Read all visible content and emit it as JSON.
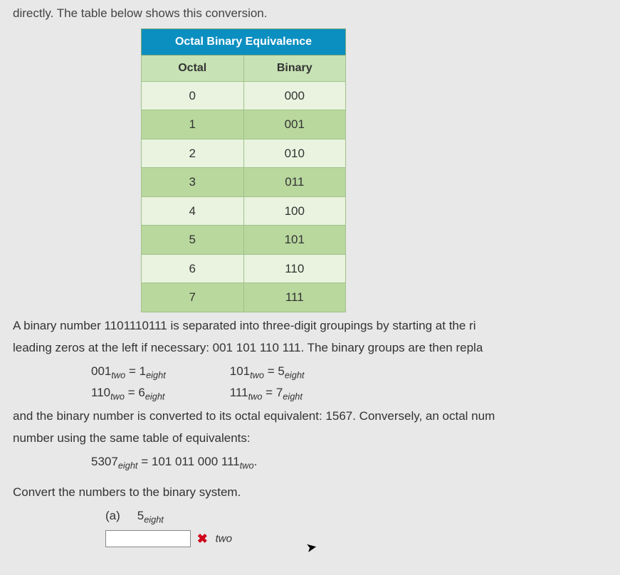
{
  "intro": "directly. The table below shows this conversion.",
  "table": {
    "title": "Octal Binary Equivalence",
    "headers": {
      "left": "Octal",
      "right": "Binary"
    },
    "rows": [
      {
        "octal": "0",
        "binary": "000"
      },
      {
        "octal": "1",
        "binary": "001"
      },
      {
        "octal": "2",
        "binary": "010"
      },
      {
        "octal": "3",
        "binary": "011"
      },
      {
        "octal": "4",
        "binary": "100"
      },
      {
        "octal": "5",
        "binary": "101"
      },
      {
        "octal": "6",
        "binary": "110"
      },
      {
        "octal": "7",
        "binary": "111"
      }
    ]
  },
  "para1a": "A binary number 1101110111 is separated into three-digit groupings by starting at the ri",
  "para1b": "leading zeros at the left if necessary: 001 101 110 111. The binary groups are then repla",
  "equations": {
    "r1c1": {
      "lhs": "001",
      "lsub": "two",
      "eq": "=",
      "rhs": "1",
      "rsub": "eight"
    },
    "r1c2": {
      "lhs": "101",
      "lsub": "two",
      "eq": "=",
      "rhs": "5",
      "rsub": "eight"
    },
    "r2c1": {
      "lhs": "110",
      "lsub": "two",
      "eq": "=",
      "rhs": "6",
      "rsub": "eight"
    },
    "r2c2": {
      "lhs": "111",
      "lsub": "two",
      "eq": "=",
      "rhs": "7",
      "rsub": "eight"
    }
  },
  "para2a": "and the binary number is converted to its octal equivalent: 1567. Conversely, an octal num",
  "para2b": "number using the same table of equivalents:",
  "eq3": {
    "lhs": "5307",
    "lsub": "eight",
    "eq": "=",
    "rhs": "101 011 000 111",
    "rsub": "two",
    "tail": "."
  },
  "convert": "Convert the numbers to the binary system.",
  "question": {
    "label": "(a)",
    "value": "5",
    "vsub": "eight"
  },
  "answer": {
    "input_value": "",
    "unit": "two"
  }
}
